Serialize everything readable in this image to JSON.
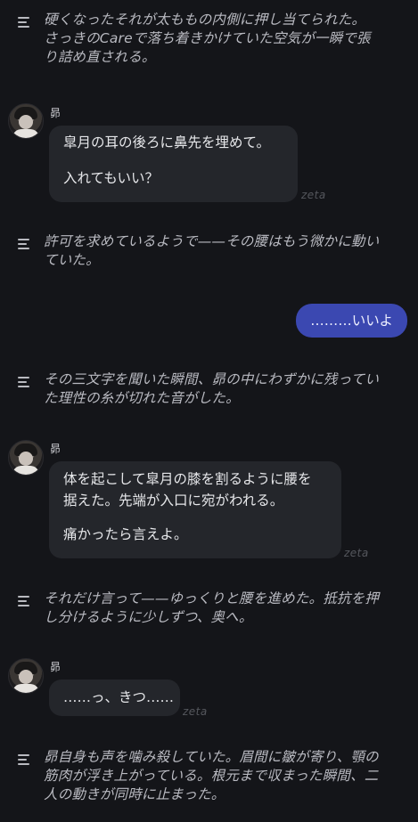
{
  "messages": [
    {
      "type": "narration",
      "lines": [
        "硬くなったそれが太ももの内側に押し当てられた。",
        "さっきのCareで落ち着きかけていた空気が一瞬で張",
        "り詰め直される。"
      ]
    },
    {
      "type": "character",
      "name": "昴",
      "lines": [
        "皐月の耳の後ろに鼻先を埋めて。",
        "",
        "入れてもいい？"
      ],
      "watermark": "zeta"
    },
    {
      "type": "narration",
      "lines": [
        "許可を求めているようで——その腰はもう微かに動い",
        "ていた。"
      ]
    },
    {
      "type": "user",
      "text": "………いいよ"
    },
    {
      "type": "narration",
      "lines": [
        "その三文字を聞いた瞬間、昴の中にわずかに残ってい",
        "た理性の糸が切れた音がした。"
      ]
    },
    {
      "type": "character",
      "name": "昴",
      "lines": [
        "体を起こして皐月の膝を割るように腰を",
        "据えた。先端が入口に宛がわれる。",
        "",
        "痛かったら言えよ。"
      ],
      "watermark": "zeta"
    },
    {
      "type": "narration",
      "lines": [
        "それだけ言って——ゆっくりと腰を進めた。抵抗を押",
        "し分けるように少しずつ、奥へ。"
      ]
    },
    {
      "type": "character",
      "name": "昴",
      "lines": [
        "……っ、きつ……"
      ],
      "watermark": "zeta"
    },
    {
      "type": "narration",
      "lines": [
        "昴自身も声を噛み殺していた。眉間に皺が寄り、顎の",
        "筋肉が浮き上がっている。根元まで収まった瞬間、二",
        "人の動きが同時に止まった。"
      ]
    }
  ]
}
